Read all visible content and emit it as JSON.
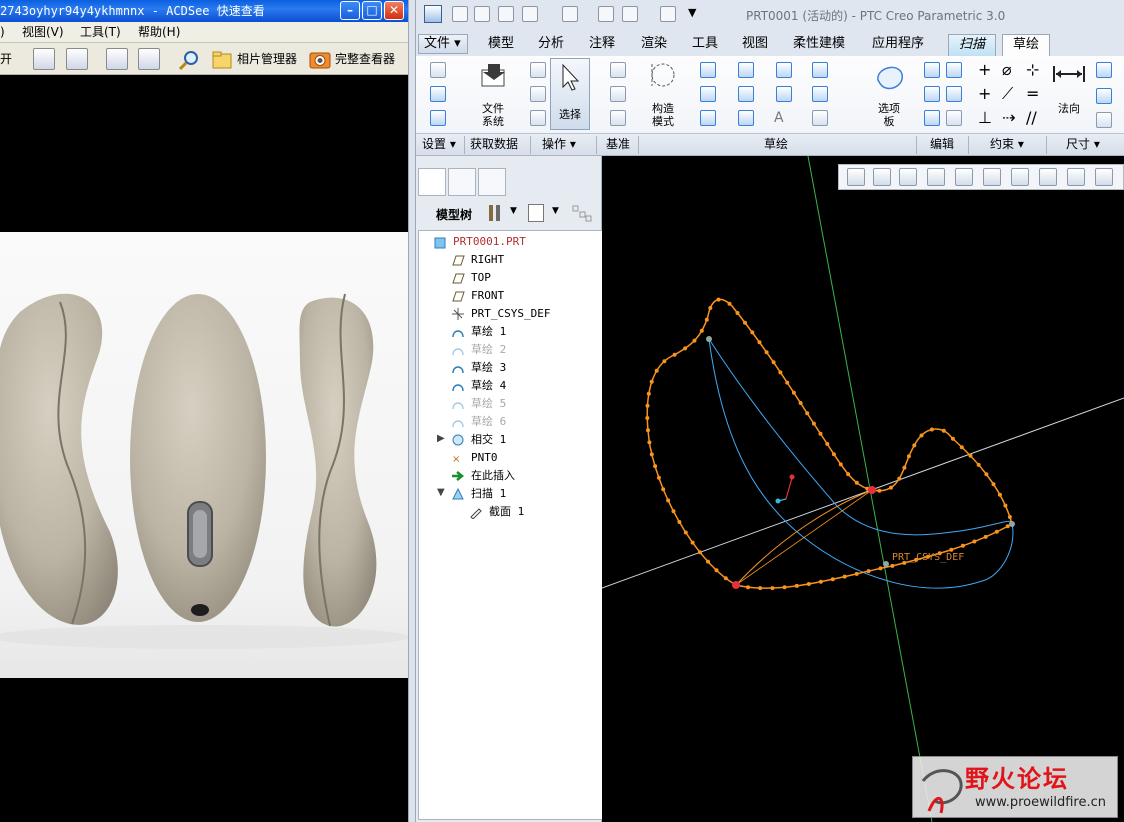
{
  "acdsee": {
    "title": "2743oyhyr94y4ykhmnnx - ACDSee 快速查看",
    "menu": [
      ")",
      "视图(V)",
      "工具(T)",
      "帮助(H)"
    ],
    "toolbar_open": "开",
    "toolbar_photo_manager": "相片管理器",
    "toolbar_full_viewer": "完整查看器"
  },
  "creo": {
    "title": "PRT0001 (活动的) - PTC Creo Parametric 3.0",
    "tabs": [
      "文件",
      "模型",
      "分析",
      "注释",
      "渲染",
      "工具",
      "视图",
      "柔性建模",
      "应用程序"
    ],
    "context_tabs": [
      "扫描",
      "草绘"
    ],
    "ribbon_labels": {
      "file_system": "文件\n系统",
      "select": "选择",
      "construction_mode": "构造\n模式",
      "palette": "选项\n板",
      "normal": "法向"
    },
    "groups": [
      "设置",
      "获取数据",
      "操作",
      "基准",
      "草绘",
      "编辑",
      "约束",
      "尺寸"
    ],
    "tree_title": "模型树",
    "tree": [
      {
        "label": "PRT0001.PRT",
        "icon": "part",
        "indent": 0,
        "state": "root"
      },
      {
        "label": "RIGHT",
        "icon": "plane",
        "indent": 1,
        "state": "normal"
      },
      {
        "label": "TOP",
        "icon": "plane",
        "indent": 1,
        "state": "normal"
      },
      {
        "label": "FRONT",
        "icon": "plane",
        "indent": 1,
        "state": "normal"
      },
      {
        "label": "PRT_CSYS_DEF",
        "icon": "csys",
        "indent": 1,
        "state": "normal"
      },
      {
        "label": "草绘 1",
        "icon": "sketch",
        "indent": 1,
        "state": "normal"
      },
      {
        "label": "草绘 2",
        "icon": "sketch",
        "indent": 1,
        "state": "hidden"
      },
      {
        "label": "草绘 3",
        "icon": "sketch",
        "indent": 1,
        "state": "normal"
      },
      {
        "label": "草绘 4",
        "icon": "sketch",
        "indent": 1,
        "state": "normal"
      },
      {
        "label": "草绘 5",
        "icon": "sketch",
        "indent": 1,
        "state": "hidden"
      },
      {
        "label": "草绘 6",
        "icon": "sketch",
        "indent": 1,
        "state": "hidden"
      },
      {
        "label": "相交 1",
        "icon": "intersect",
        "indent": 1,
        "state": "expandable"
      },
      {
        "label": "PNT0",
        "icon": "point",
        "indent": 1,
        "state": "normal"
      },
      {
        "label": "在此插入",
        "icon": "insert-arrow",
        "indent": 1,
        "state": "normal"
      },
      {
        "label": "扫描 1",
        "icon": "sweep",
        "indent": 1,
        "state": "expanded"
      },
      {
        "label": "截面 1",
        "icon": "section",
        "indent": 2,
        "state": "normal"
      }
    ],
    "csys_label": "PRT_CSYS_DEF",
    "watermark_title": "野火论坛",
    "watermark_url": "www.proewildfire.cn",
    "colors": {
      "curve": "#f7941d",
      "trajectory": "#3fa9f5",
      "datum_green": "#3ab54a",
      "datum_white": "#cfd3dc"
    }
  }
}
